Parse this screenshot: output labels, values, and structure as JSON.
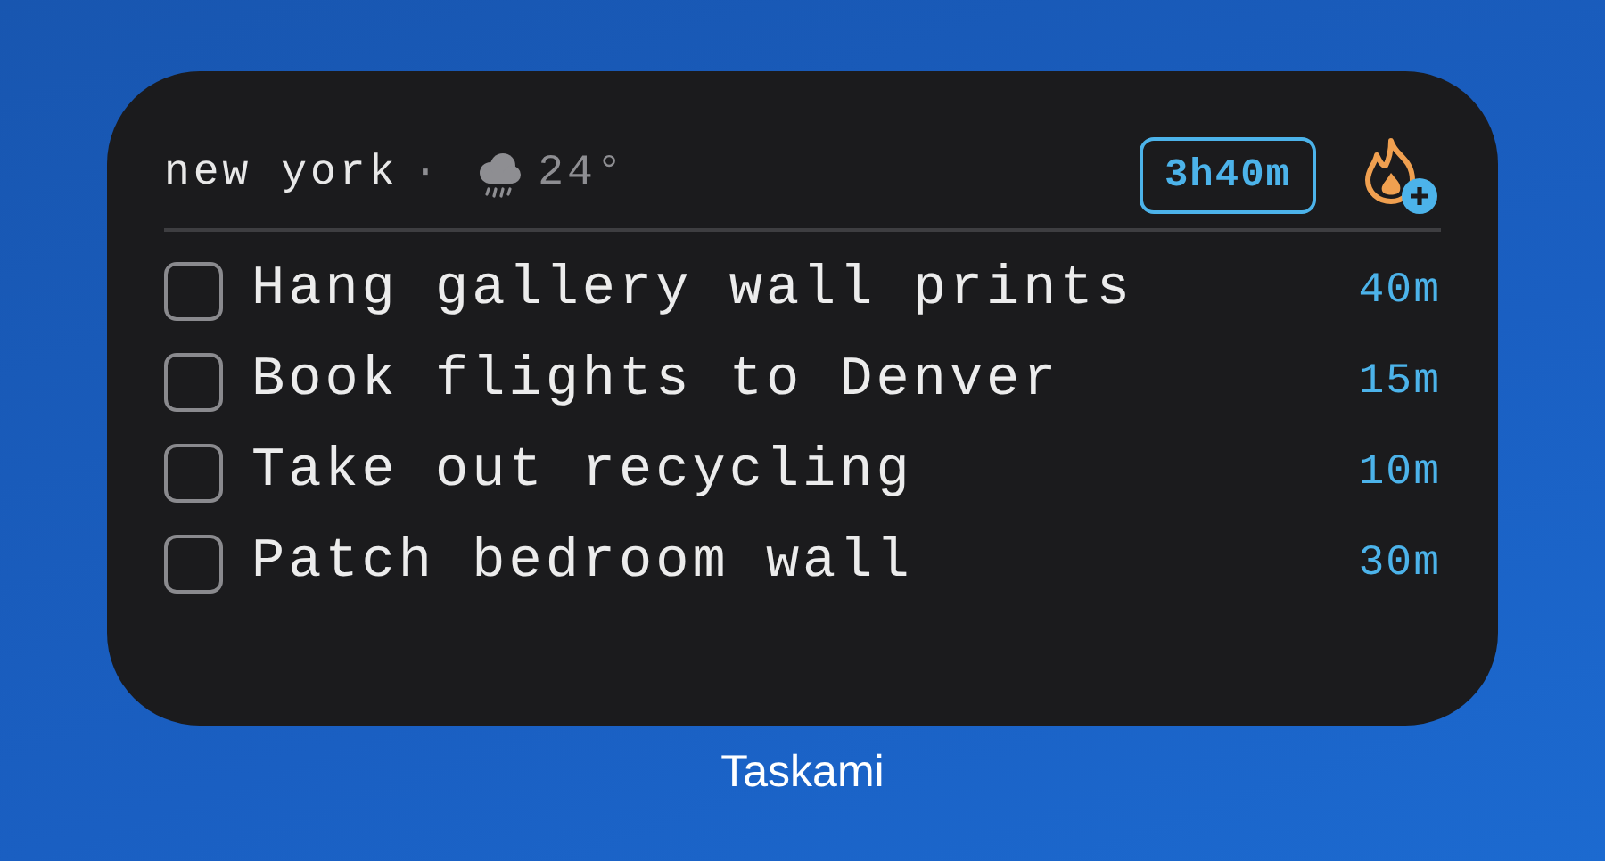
{
  "header": {
    "location": "new york",
    "separator": "·",
    "temperature": "24°",
    "timer": "3h40m"
  },
  "tasks": [
    {
      "title": "Hang gallery wall prints",
      "checked": false,
      "duration": "40m"
    },
    {
      "title": "Book flights to Denver",
      "checked": false,
      "duration": "15m"
    },
    {
      "title": "Take out recycling",
      "checked": false,
      "duration": "10m"
    },
    {
      "title": "Patch bedroom wall",
      "checked": false,
      "duration": "30m"
    }
  ],
  "widget_label": "Taskami"
}
